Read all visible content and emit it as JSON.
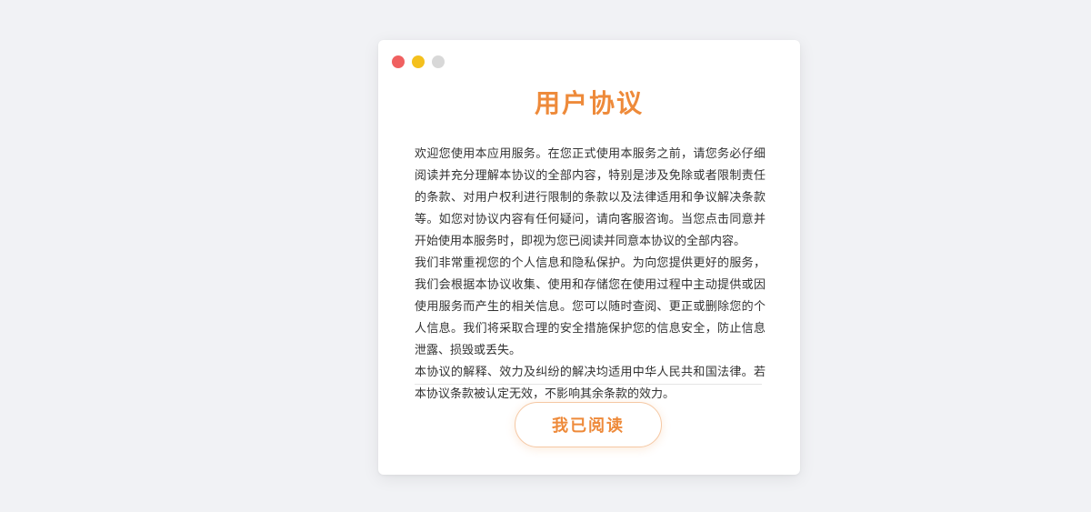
{
  "window": {
    "controls": [
      {
        "name": "close",
        "color": "#f06060"
      },
      {
        "name": "minimize",
        "color": "#f4c01d"
      },
      {
        "name": "zoom",
        "color": "#d8d8d8"
      }
    ]
  },
  "dialog": {
    "title": "用户协议",
    "accent_color": "#ee8a3a",
    "paragraphs": [
      "欢迎您使用本应用服务。在您正式使用本服务之前，请您务必仔细阅读并充分理解本协议的全部内容，特别是涉及免除或者限制责任的条款、对用户权利进行限制的条款以及法律适用和争议解决条款等。如您对协议内容有任何疑问，请向客服咨询。当您点击同意并开始使用本服务时，即视为您已阅读并同意本协议的全部内容。",
      "我们非常重视您的个人信息和隐私保护。为向您提供更好的服务，我们会根据本协议收集、使用和存储您在使用过程中主动提供或因使用服务而产生的相关信息。您可以随时查阅、更正或删除您的个人信息。我们将采取合理的安全措施保护您的信息安全，防止信息泄露、损毁或丢失。",
      "本协议的解释、效力及纠纷的解决均适用中华人民共和国法律。若本协议条款被认定无效，不影响其余条款的效力。"
    ],
    "confirm_label": "我已阅读"
  }
}
